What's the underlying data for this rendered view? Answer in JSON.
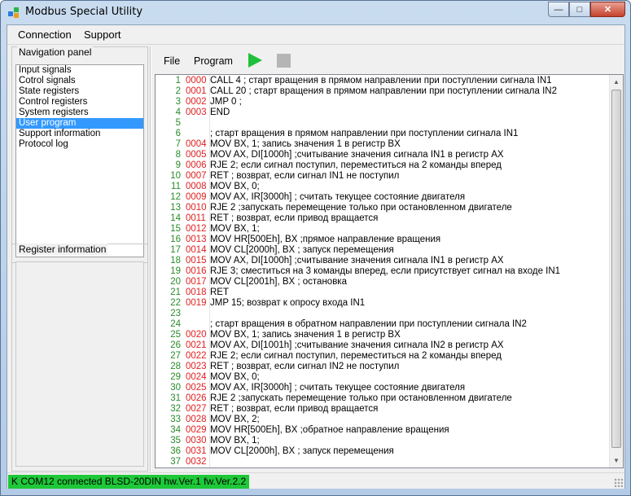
{
  "window": {
    "title": "Modbus Special Utility"
  },
  "caption": {
    "minimize": "—",
    "maximize": "□",
    "close": "✕"
  },
  "menu": {
    "items": [
      "Connection",
      "Support"
    ]
  },
  "navigation": {
    "title": "Navigation panel",
    "items": [
      "Input signals",
      "Cotrol signals",
      "State registers",
      "Control registers",
      "System registers",
      "User program",
      "Support information",
      "Protocol log"
    ],
    "selected": "User program"
  },
  "register_info": {
    "title": "Register information"
  },
  "toolbar": {
    "file": "File",
    "program": "Program",
    "run_icon": "play-icon",
    "stop_icon": "stop-icon"
  },
  "editor": {
    "lines": [
      {
        "n": "1",
        "addr": "0000",
        "code": "CALL 4 ; старт вращения в прямом направлении при поступлении сигнала IN1"
      },
      {
        "n": "2",
        "addr": "0001",
        "code": "CALL 20 ; старт вращения в прямом направлении при поступлении сигнала IN2"
      },
      {
        "n": "3",
        "addr": "0002",
        "code": "JMP 0 ;"
      },
      {
        "n": "4",
        "addr": "0003",
        "code": "END"
      },
      {
        "n": "5",
        "addr": "",
        "code": ""
      },
      {
        "n": "6",
        "addr": "",
        "code": "; старт вращения в прямом направлении при поступлении сигнала IN1"
      },
      {
        "n": "7",
        "addr": "0004",
        "code": "MOV BX, 1; запись значения 1 в регистр BX"
      },
      {
        "n": "8",
        "addr": "0005",
        "code": "MOV AX, DI[1000h] ;считывание значения сигнала IN1 в регистр AX"
      },
      {
        "n": "9",
        "addr": "0006",
        "code": "RJE 2; если сигнал поступил, переместиться на 2 команды вперед"
      },
      {
        "n": "10",
        "addr": "0007",
        "code": "RET ; возврат, если сигнал IN1 не поступил"
      },
      {
        "n": "11",
        "addr": "0008",
        "code": "MOV BX, 0;"
      },
      {
        "n": "12",
        "addr": "0009",
        "code": "MOV AX, IR[3000h] ; считать текущее состояние двигателя"
      },
      {
        "n": "13",
        "addr": "0010",
        "code": "RJE 2 ;запускать перемещение только при остановленном двигателе"
      },
      {
        "n": "14",
        "addr": "0011",
        "code": "RET ; возврат, если привод вращается"
      },
      {
        "n": "15",
        "addr": "0012",
        "code": "MOV BX, 1;"
      },
      {
        "n": "16",
        "addr": "0013",
        "code": "MOV HR[500Eh], BX ;прямое направление вращения"
      },
      {
        "n": "17",
        "addr": "0014",
        "code": "MOV CL[2000h], BX ; запуск перемещения"
      },
      {
        "n": "18",
        "addr": "0015",
        "code": "MOV AX, DI[1000h] ;считывание значения сигнала IN1 в регистр AX"
      },
      {
        "n": "19",
        "addr": "0016",
        "code": "RJE 3; сместиться на 3 команды вперед, если присутствует сигнал на входе IN1"
      },
      {
        "n": "20",
        "addr": "0017",
        "code": "MOV CL[2001h], BX ; остановка"
      },
      {
        "n": "21",
        "addr": "0018",
        "code": "RET"
      },
      {
        "n": "22",
        "addr": "0019",
        "code": "JMP 15; возврат к опросу входа IN1"
      },
      {
        "n": "23",
        "addr": "",
        "code": ""
      },
      {
        "n": "24",
        "addr": "",
        "code": "; старт вращения в обратном направлении при поступлении сигнала IN2"
      },
      {
        "n": "25",
        "addr": "0020",
        "code": "MOV BX, 1; запись значения 1 в регистр BX"
      },
      {
        "n": "26",
        "addr": "0021",
        "code": "MOV AX, DI[1001h] ;считывание значения сигнала IN2 в регистр AX"
      },
      {
        "n": "27",
        "addr": "0022",
        "code": "RJE 2; если сигнал поступил, переместиться на 2 команды вперед"
      },
      {
        "n": "28",
        "addr": "0023",
        "code": "RET ; возврат, если сигнал IN2 не поступил"
      },
      {
        "n": "29",
        "addr": "0024",
        "code": "MOV BX, 0;"
      },
      {
        "n": "30",
        "addr": "0025",
        "code": "MOV AX, IR[3000h] ; считать текущее состояние двигателя"
      },
      {
        "n": "31",
        "addr": "0026",
        "code": "RJE 2 ;запускать перемещение только при остановленном двигателе"
      },
      {
        "n": "32",
        "addr": "0027",
        "code": "RET ; возврат, если привод вращается"
      },
      {
        "n": "33",
        "addr": "0028",
        "code": "MOV BX, 2;"
      },
      {
        "n": "34",
        "addr": "0029",
        "code": "MOV HR[500Eh], BX ;обратное направление вращения"
      },
      {
        "n": "35",
        "addr": "0030",
        "code": "MOV BX, 1;"
      },
      {
        "n": "36",
        "addr": "0031",
        "code": "MOV CL[2000h], BX ; запуск перемещения"
      },
      {
        "n": "37",
        "addr": "0032",
        "code": ""
      }
    ]
  },
  "status": {
    "text": "K COM12 connected  BLSD-20DIN hw.Ver.1 fw.Ver.2.2",
    "color": "#1ec838"
  },
  "colors": {
    "line_number": "#2a8a2a",
    "address": "#e02020",
    "selection": "#3399ff",
    "run": "#1fbf3a"
  }
}
